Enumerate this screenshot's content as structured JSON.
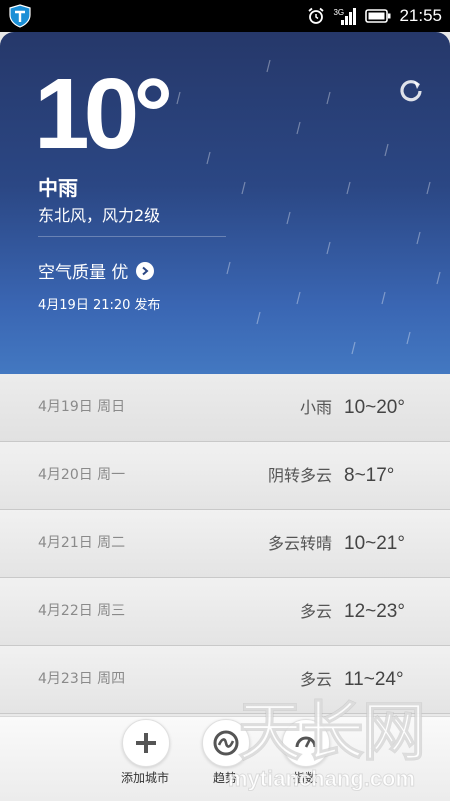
{
  "status_bar": {
    "time": "21:55",
    "network": "3G"
  },
  "weather": {
    "temperature": "10°",
    "condition": "中雨",
    "wind": "东北风，风力2级",
    "air_quality": "空气质量 优",
    "publish_time": "4月19日 21:20 发布"
  },
  "forecast": [
    {
      "date": "4月19日 周日",
      "condition": "小雨",
      "temp": "10~20°"
    },
    {
      "date": "4月20日 周一",
      "condition": "阴转多云",
      "temp": "8~17°"
    },
    {
      "date": "4月21日 周二",
      "condition": "多云转晴",
      "temp": "10~21°"
    },
    {
      "date": "4月22日 周三",
      "condition": "多云",
      "temp": "12~23°"
    },
    {
      "date": "4月23日 周四",
      "condition": "多云",
      "temp": "11~24°"
    }
  ],
  "bottom_bar": {
    "add_city": "添加城市",
    "trend": "趋势",
    "index": "指数"
  },
  "watermark": {
    "text_cn": "天长网",
    "text_en": "mytianchang.com"
  },
  "colors": {
    "card_top": "#26386a",
    "card_bottom": "#4378c1",
    "list_bg": "#e9e9e9"
  },
  "icons": [
    "shield-app-icon",
    "alarm-icon",
    "signal-icon",
    "battery-icon",
    "refresh-icon",
    "chevron-right-icon",
    "plus-icon",
    "trend-icon",
    "index-icon"
  ]
}
